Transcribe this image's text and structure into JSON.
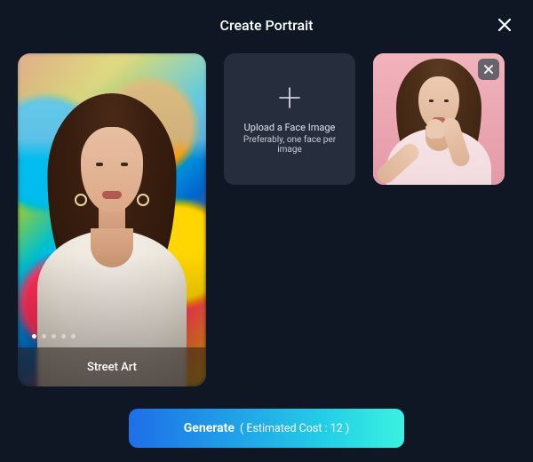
{
  "header": {
    "title": "Create Portrait"
  },
  "styleCard": {
    "caption": "Street Art",
    "dotCount": 5,
    "activeDot": 0
  },
  "upload": {
    "line1": "Upload a Face Image",
    "line2": "Preferably, one face per image"
  },
  "generate": {
    "label": "Generate",
    "costPrefix": "( Estimated Cost : ",
    "costValue": "12",
    "costSuffix": " )"
  },
  "icons": {
    "close": "close-icon",
    "plus": "plus-icon",
    "remove": "remove-icon"
  }
}
